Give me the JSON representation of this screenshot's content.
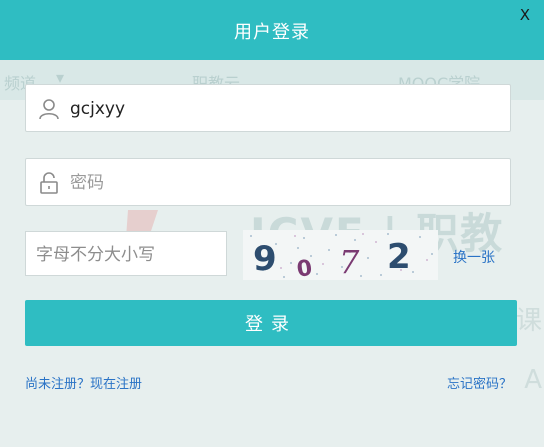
{
  "dialog": {
    "title": "用户登录",
    "close_label": "X"
  },
  "background": {
    "nav_items": [
      "频道",
      "职教云",
      "MOOC学院"
    ],
    "brand_text": "ICVE | 职教"
  },
  "form": {
    "username": {
      "value": "gcjxyy",
      "icon": "user-icon"
    },
    "password": {
      "placeholder": "密码",
      "icon": "lock-icon"
    },
    "captcha": {
      "placeholder": "字母不分大小写",
      "chars": [
        "9",
        "0",
        "7",
        "2"
      ],
      "refresh_label": "换一张"
    },
    "submit_label": "登录"
  },
  "footer": {
    "register_link": "尚未注册？现在注册",
    "forgot_link": "忘记密码？"
  },
  "colors": {
    "accent": "#2fbdc2",
    "link": "#2a73c6"
  }
}
